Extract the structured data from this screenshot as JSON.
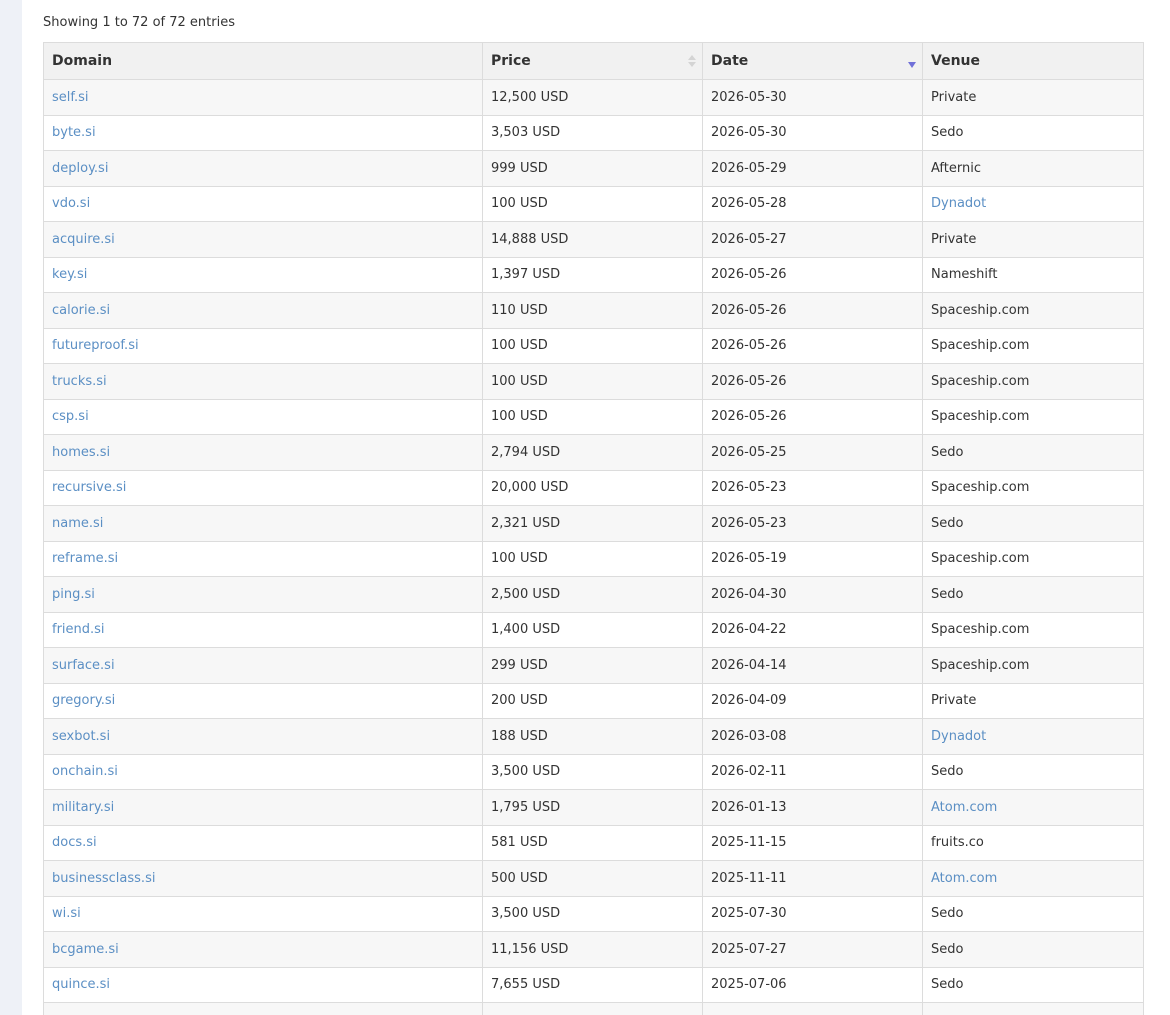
{
  "table_info": "Showing 1 to 72 of 72 entries",
  "colors": {
    "link": "#5b8fc4",
    "sort_active": "#7070d8"
  },
  "icons": {
    "price_sort": "sort-both-icon",
    "date_sort": "sort-desc-icon"
  },
  "columns": [
    {
      "label": "Domain"
    },
    {
      "label": "Price"
    },
    {
      "label": "Date"
    },
    {
      "label": "Venue"
    }
  ],
  "rows": [
    {
      "domain": "self.si",
      "price": "12,500 USD",
      "date": "2026-05-30",
      "venue": "Private",
      "venue_link": false
    },
    {
      "domain": "byte.si",
      "price": "3,503 USD",
      "date": "2026-05-30",
      "venue": "Sedo",
      "venue_link": false
    },
    {
      "domain": "deploy.si",
      "price": "999 USD",
      "date": "2026-05-29",
      "venue": "Afternic",
      "venue_link": false
    },
    {
      "domain": "vdo.si",
      "price": "100 USD",
      "date": "2026-05-28",
      "venue": "Dynadot",
      "venue_link": true
    },
    {
      "domain": "acquire.si",
      "price": "14,888 USD",
      "date": "2026-05-27",
      "venue": "Private",
      "venue_link": false
    },
    {
      "domain": "key.si",
      "price": "1,397 USD",
      "date": "2026-05-26",
      "venue": "Nameshift",
      "venue_link": false
    },
    {
      "domain": "calorie.si",
      "price": "110 USD",
      "date": "2026-05-26",
      "venue": "Spaceship.com",
      "venue_link": false
    },
    {
      "domain": "futureproof.si",
      "price": "100 USD",
      "date": "2026-05-26",
      "venue": "Spaceship.com",
      "venue_link": false
    },
    {
      "domain": "trucks.si",
      "price": "100 USD",
      "date": "2026-05-26",
      "venue": "Spaceship.com",
      "venue_link": false
    },
    {
      "domain": "csp.si",
      "price": "100 USD",
      "date": "2026-05-26",
      "venue": "Spaceship.com",
      "venue_link": false
    },
    {
      "domain": "homes.si",
      "price": "2,794 USD",
      "date": "2026-05-25",
      "venue": "Sedo",
      "venue_link": false
    },
    {
      "domain": "recursive.si",
      "price": "20,000 USD",
      "date": "2026-05-23",
      "venue": "Spaceship.com",
      "venue_link": false
    },
    {
      "domain": "name.si",
      "price": "2,321 USD",
      "date": "2026-05-23",
      "venue": "Sedo",
      "venue_link": false
    },
    {
      "domain": "reframe.si",
      "price": "100 USD",
      "date": "2026-05-19",
      "venue": "Spaceship.com",
      "venue_link": false
    },
    {
      "domain": "ping.si",
      "price": "2,500 USD",
      "date": "2026-04-30",
      "venue": "Sedo",
      "venue_link": false
    },
    {
      "domain": "friend.si",
      "price": "1,400 USD",
      "date": "2026-04-22",
      "venue": "Spaceship.com",
      "venue_link": false
    },
    {
      "domain": "surface.si",
      "price": "299 USD",
      "date": "2026-04-14",
      "venue": "Spaceship.com",
      "venue_link": false
    },
    {
      "domain": "gregory.si",
      "price": "200 USD",
      "date": "2026-04-09",
      "venue": "Private",
      "venue_link": false
    },
    {
      "domain": "sexbot.si",
      "price": "188 USD",
      "date": "2026-03-08",
      "venue": "Dynadot",
      "venue_link": true
    },
    {
      "domain": "onchain.si",
      "price": "3,500 USD",
      "date": "2026-02-11",
      "venue": "Sedo",
      "venue_link": false
    },
    {
      "domain": "military.si",
      "price": "1,795 USD",
      "date": "2026-01-13",
      "venue": "Atom.com",
      "venue_link": true
    },
    {
      "domain": "docs.si",
      "price": "581 USD",
      "date": "2025-11-15",
      "venue": "fruits.co",
      "venue_link": false
    },
    {
      "domain": "businessclass.si",
      "price": "500 USD",
      "date": "2025-11-11",
      "venue": "Atom.com",
      "venue_link": true
    },
    {
      "domain": "wi.si",
      "price": "3,500 USD",
      "date": "2025-07-30",
      "venue": "Sedo",
      "venue_link": false
    },
    {
      "domain": "bcgame.si",
      "price": "11,156 USD",
      "date": "2025-07-27",
      "venue": "Sedo",
      "venue_link": false
    },
    {
      "domain": "quince.si",
      "price": "7,655 USD",
      "date": "2025-07-06",
      "venue": "Sedo",
      "venue_link": false
    },
    {
      "domain": "",
      "price": "",
      "date": "",
      "venue": "",
      "venue_link": false
    }
  ]
}
